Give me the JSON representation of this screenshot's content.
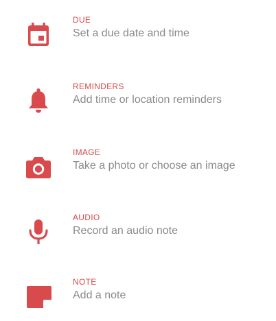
{
  "accent_color": "#d84a4c",
  "subtitle_color": "#8a8a8a",
  "items": [
    {
      "icon": "calendar-icon",
      "title": "DUE",
      "subtitle": "Set a due date and time"
    },
    {
      "icon": "bell-icon",
      "title": "REMINDERS",
      "subtitle": "Add time or location reminders"
    },
    {
      "icon": "camera-icon",
      "title": "IMAGE",
      "subtitle": "Take a photo or choose an image"
    },
    {
      "icon": "microphone-icon",
      "title": "AUDIO",
      "subtitle": "Record an audio note"
    },
    {
      "icon": "note-icon",
      "title": "NOTE",
      "subtitle": "Add a note"
    }
  ]
}
